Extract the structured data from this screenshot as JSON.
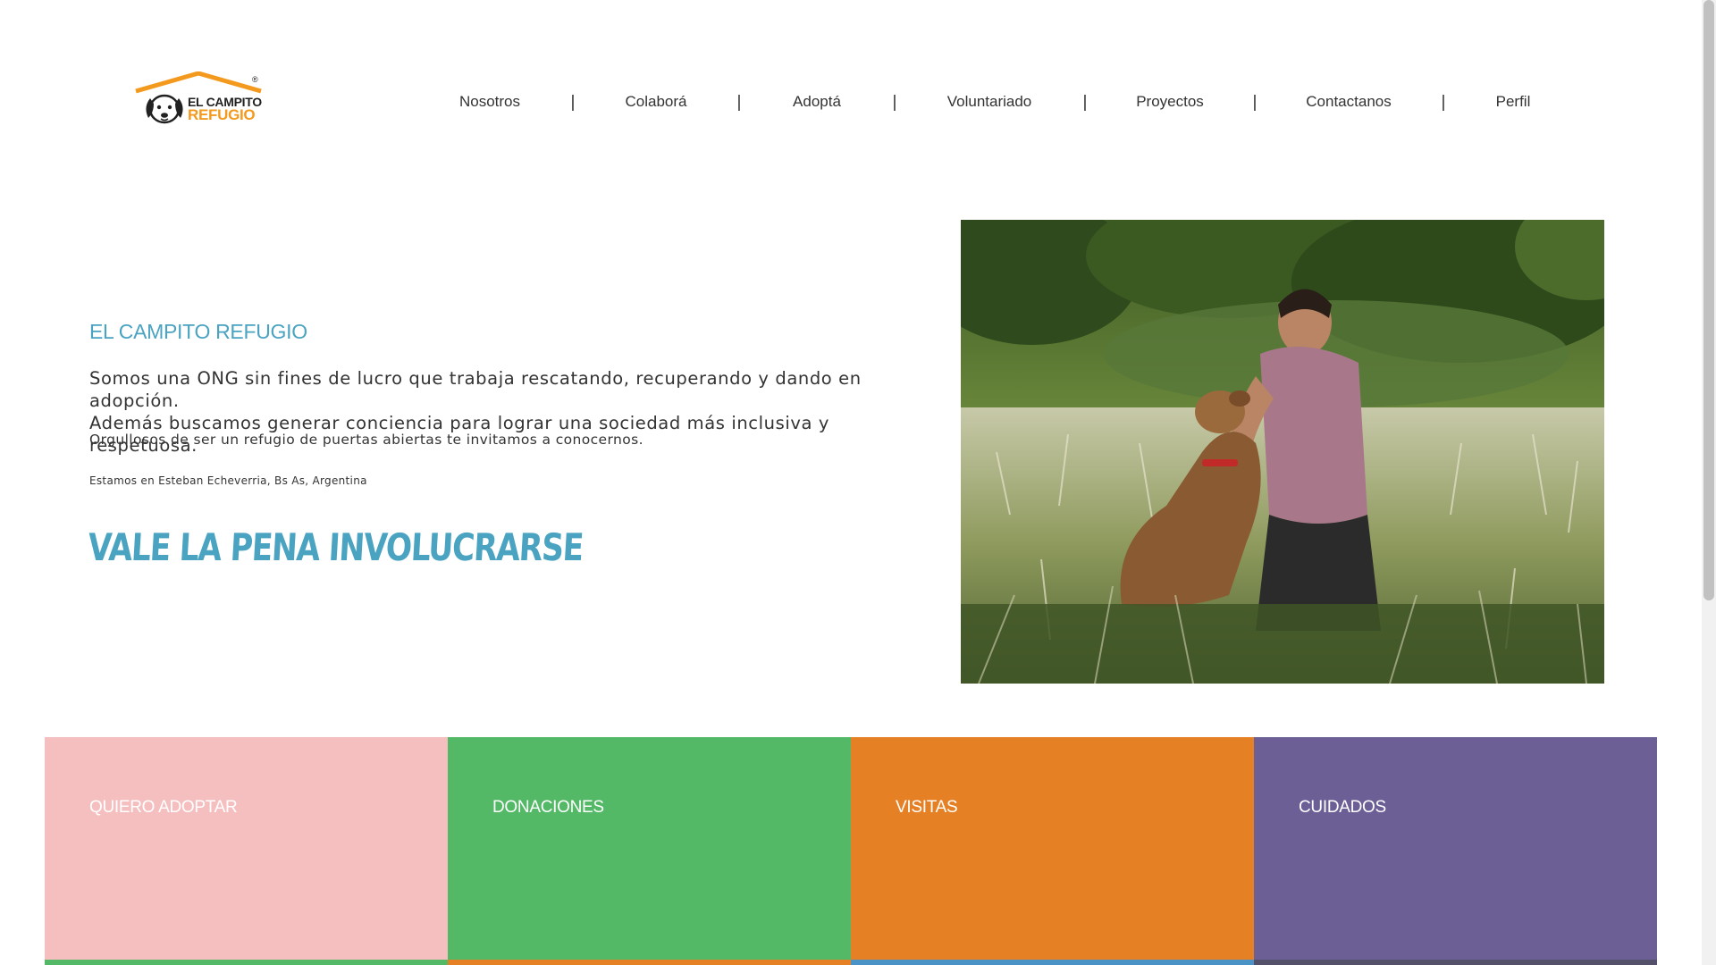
{
  "header": {
    "logo": {
      "line1": "EL CAMPITO",
      "line2": "REFUGIO",
      "reg": "®"
    },
    "nav": [
      {
        "label": "Nosotros"
      },
      {
        "label": "Colaborá"
      },
      {
        "label": "Adoptá"
      },
      {
        "label": "Voluntariado"
      },
      {
        "label": "Proyectos"
      },
      {
        "label": "Contactanos"
      },
      {
        "label": "Perfil"
      }
    ],
    "separator": "|"
  },
  "hero": {
    "heading": "EL CAMPITO REFUGIO",
    "paragraph_line1": "Somos una ONG sin fines de lucro que trabaja rescatando, recuperando y dando en adopción.",
    "paragraph_line2": "Además buscamos generar conciencia para lograr una sociedad más inclusiva y respetuosa.",
    "paragraph2": "Orgullosos de ser un refugio de puertas abiertas te invitamos a conocernos.",
    "location": "Estamos en Esteban Echeverria, Bs As, Argentina",
    "tagline": "VALE LA PENA INVOLUCRARSE"
  },
  "cards": [
    {
      "label": "QUIERO ADOPTAR",
      "color": "#f5bfc0",
      "strip": "#53b967"
    },
    {
      "label": "DONACIONES",
      "color": "#53b967",
      "strip": "#e58025"
    },
    {
      "label": "VISITAS",
      "color": "#e58025",
      "strip": "#4a93c6"
    },
    {
      "label": "CUIDADOS",
      "color": "#6b5f96",
      "strip": "#54506a"
    }
  ],
  "colors": {
    "accent": "#4aa3c1",
    "logo_orange": "#f39a1e"
  }
}
